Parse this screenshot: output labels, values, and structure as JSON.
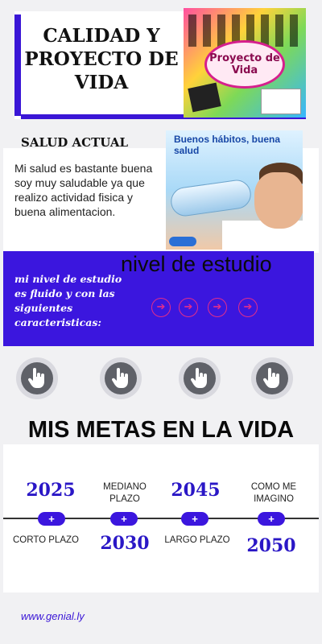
{
  "header": {
    "title": "CALIDAD Y PROYECTO DE VIDA",
    "image_text": "Proyecto de Vida"
  },
  "salud": {
    "title": "SALUD ACTUAL",
    "text": "Mi salud es bastante buena soy muy saludable ya que realizo actividad fisica y buena alimentacion.",
    "image_caption": "Buenos hábitos, buena salud"
  },
  "estudio": {
    "heading": "nivel de estudio",
    "text": "mi nivel de estudio es fluido y con las siguientes caracteristicas:",
    "arrow_icon": "arrow-right-icon",
    "arrow_count": 4
  },
  "buttons": {
    "icon": "pointer-hand-icon",
    "count": 4
  },
  "metas": {
    "title": "MIS METAS EN LA VIDA",
    "badge": "+",
    "items": [
      {
        "year": "2025",
        "label": "CORTO PLAZO"
      },
      {
        "year": "2030",
        "label": "MEDIANO PLAZO"
      },
      {
        "year": "2045",
        "label": "LARGO PLAZO"
      },
      {
        "year": "2050",
        "label": "COMO ME IMAGINO"
      }
    ]
  },
  "footer": {
    "link": "www.genial.ly"
  },
  "colors": {
    "accent": "#3b16de",
    "arrow": "#e22d8c",
    "year": "#2a17c6",
    "background": "#f1f1f3"
  }
}
